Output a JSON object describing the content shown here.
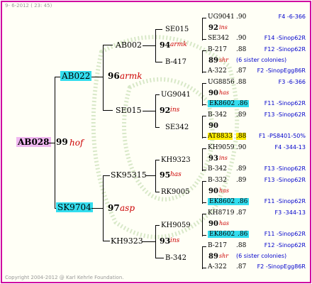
{
  "header": {
    "date": "9- 6-2012 ( 23: 45)"
  },
  "footer": {
    "copyright": "Copyright 2004-2012 @ Karl Kehrle Foundation."
  },
  "root": {
    "id": "AB028",
    "num": "99",
    "tag": "hof"
  },
  "gen1": [
    {
      "id": "AB022",
      "num": "96",
      "tag": "armk"
    },
    {
      "id": "SK9704",
      "num": "97",
      "tag": "asp"
    }
  ],
  "gen2": [
    {
      "id": "AB002",
      "num": "94",
      "tag": "armk"
    },
    {
      "id": "SE015",
      "num": "92",
      "tag": "ins"
    },
    {
      "id": "SK95315",
      "num": "95",
      "tag": "has"
    },
    {
      "id": "KH9323",
      "num": "93",
      "tag": "ins"
    }
  ],
  "gen3": [
    {
      "id": "SE015"
    },
    {
      "id": "B-417"
    },
    {
      "id": "UG9041"
    },
    {
      "id": "SE342"
    },
    {
      "id": "KH9323"
    },
    {
      "id": "RK9005"
    },
    {
      "id": "KH9059"
    },
    {
      "id": "B-342"
    }
  ],
  "gen4": [
    {
      "id": "UG9041",
      "year": ".90",
      "ref": "F4 -6-366"
    },
    {
      "id": "SE342",
      "year": ".90",
      "ref": "F14 -Sinop62R"
    },
    {
      "id": "B-217",
      "year": ".88",
      "ref": "F12 -Sinop62R"
    },
    {
      "id": "A-322",
      "year": ".87",
      "ref": "F2 -SinopEgg86R"
    },
    {
      "id": "UG8856",
      "year": ".88",
      "ref": "F3 -6-366"
    },
    {
      "id": "EK8602",
      "year": ".86",
      "ref": "F11 -Sinop62R"
    },
    {
      "id": "B-342",
      "year": ".89",
      "ref": "F13 -Sinop62R"
    },
    {
      "id": "AT8833",
      "year": ".88",
      "ref": "F1 -PS8401-50%"
    },
    {
      "id": "KH9059",
      "year": ".90",
      "ref": "F4 -344-13"
    },
    {
      "id": "B-342",
      "year": ".89",
      "ref": "F13 -Sinop62R"
    },
    {
      "id": "B-332",
      "year": ".89",
      "ref": "F13 -Sinop62R"
    },
    {
      "id": "EK8602",
      "year": ".86",
      "ref": "F11 -Sinop62R"
    },
    {
      "id": "KH8719",
      "year": ".87",
      "ref": "F3 -344-13"
    },
    {
      "id": "EK8602",
      "year": ".86",
      "ref": "F11 -Sinop62R"
    },
    {
      "id": "B-217",
      "year": ".88",
      "ref": "F12 -Sinop62R"
    },
    {
      "id": "A-322",
      "year": ".87",
      "ref": "F2 -SinopEgg86R"
    }
  ],
  "gen4mid": [
    {
      "num": "92",
      "tag": "ins"
    },
    {
      "num": "89",
      "tag": "shr",
      "note": "(6 sister colonies)"
    },
    {
      "num": "90",
      "tag": "has"
    },
    {
      "num": "90",
      "tag": ""
    },
    {
      "num": "93",
      "tag": "ins"
    },
    {
      "num": "90",
      "tag": "has"
    },
    {
      "num": "90",
      "tag": "has"
    },
    {
      "num": "89",
      "tag": "shr",
      "note": "(6 sister colonies)"
    }
  ],
  "colors": {
    "border": "#d000a0",
    "highlight_cyan": "#33ddee",
    "highlight_pink": "#f0b8f0",
    "highlight_yellow": "#ffee00",
    "ref_blue": "#0000cc",
    "tag_red": "#cc0000"
  }
}
